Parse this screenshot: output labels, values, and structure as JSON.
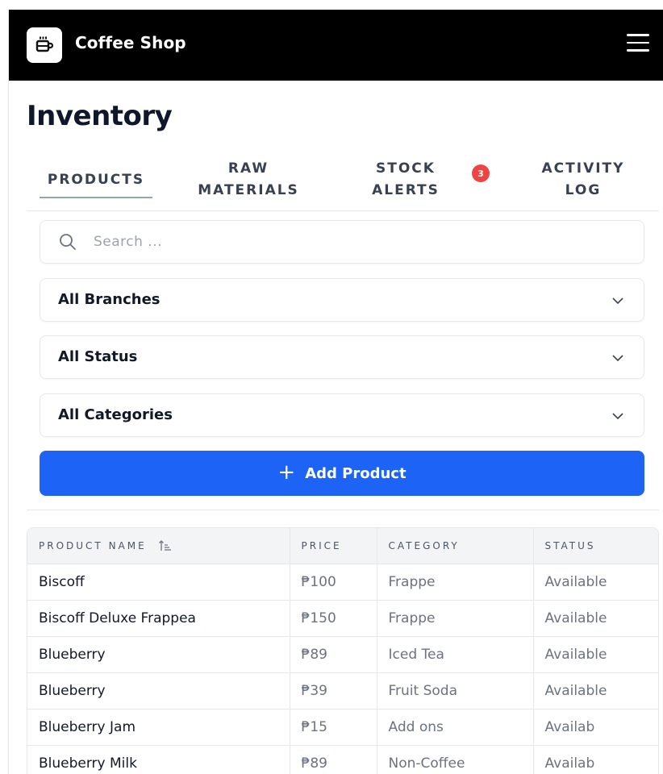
{
  "app": {
    "title": "Coffee Shop",
    "logo_icon": "coffee-cup-icon",
    "menu_icon": "hamburger-menu-icon"
  },
  "page": {
    "title": "Inventory"
  },
  "tabs": [
    {
      "line1": "PRODUCTS",
      "line2": "",
      "active": true
    },
    {
      "line1": "RAW",
      "line2": "MATERIALS",
      "active": false
    },
    {
      "line1": "STOCK",
      "line2": "ALERTS",
      "active": false,
      "badge": "3"
    },
    {
      "line1": "ACTIVITY",
      "line2": "LOG",
      "active": false
    }
  ],
  "search": {
    "placeholder": "Search ...",
    "value": ""
  },
  "filters": {
    "branch": "All Branches",
    "status": "All Status",
    "category": "All Categories"
  },
  "add_button": {
    "label": "Add Product",
    "icon": "plus-icon"
  },
  "table": {
    "columns": [
      "PRODUCT NAME",
      "PRICE",
      "CATEGORY",
      "STATUS"
    ],
    "sort_icon": "sort-ascending-icon",
    "rows": [
      {
        "name": "Biscoff",
        "price": "₱100",
        "category": "Frappe",
        "status": "Available"
      },
      {
        "name": "Biscoff Deluxe Frappea",
        "price": "₱150",
        "category": "Frappe",
        "status": "Available"
      },
      {
        "name": "Blueberry",
        "price": "₱89",
        "category": "Iced Tea",
        "status": "Available"
      },
      {
        "name": "Blueberry",
        "price": "₱39",
        "category": "Fruit Soda",
        "status": "Available"
      },
      {
        "name": "Blueberry Jam",
        "price": "₱15",
        "category": "Add ons",
        "status": "Availab"
      },
      {
        "name": "Blueberry Milk",
        "price": "₱89",
        "category": "Non-Coffee",
        "status": "Availab"
      }
    ]
  },
  "colors": {
    "topbar": "#000000",
    "primary": "#1d63f5",
    "badge": "#ef4444"
  }
}
